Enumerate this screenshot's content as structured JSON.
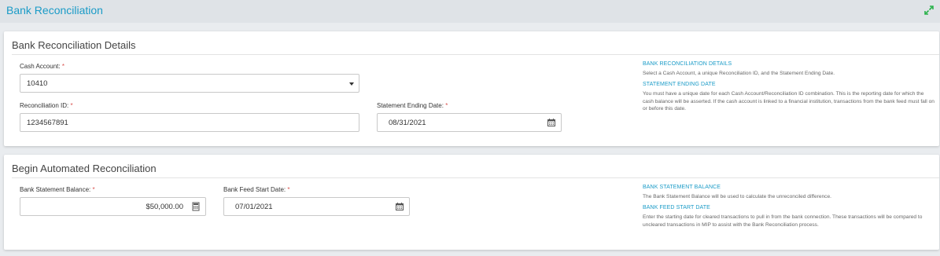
{
  "header": {
    "title": "Bank Reconciliation",
    "expand_icon": "expand-arrows-icon"
  },
  "details": {
    "title": "Bank Reconciliation Details",
    "cash_account": {
      "label": "Cash Account:",
      "required": "*",
      "value": "10410"
    },
    "reconciliation_id": {
      "label": "Reconciliation ID:",
      "required": "*",
      "value": "1234567891"
    },
    "statement_ending_date": {
      "label": "Statement Ending Date:",
      "required": "*",
      "value": "08/31/2021",
      "icon": "calendar-icon"
    },
    "help": [
      {
        "heading": "BANK RECONCILIATION DETAILS",
        "text": "Select a Cash Account, a unique Reconciliation ID, and the Statement Ending Date."
      },
      {
        "heading": "STATEMENT ENDING DATE",
        "text": "You must have a unique date for each Cash Account/Reconciliation ID combination. This is the reporting date for which the cash balance will be asserted. If the cash account is linked to a financial institution, transactions from the bank feed must fall on or before this date."
      }
    ]
  },
  "automated": {
    "title": "Begin Automated Reconciliation",
    "bank_statement_balance": {
      "label": "Bank Statement Balance:",
      "required": "*",
      "value": "$50,000.00",
      "icon": "calculator-icon"
    },
    "bank_feed_start_date": {
      "label": "Bank Feed Start Date:",
      "required": "*",
      "value": "07/01/2021",
      "icon": "calendar-icon"
    },
    "help": [
      {
        "heading": "BANK STATEMENT BALANCE",
        "text": "The Bank Statement Balance will be used to calculate the unreconciled difference."
      },
      {
        "heading": "BANK FEED START DATE",
        "text": "Enter the starting date for cleared transactions to pull in from the bank connection. These transactions will be compared to uncleared transactions in MIP to assist with the Bank Reconciliation process."
      }
    ]
  },
  "colors": {
    "accent": "#1a9bc7",
    "required": "#d9534f"
  }
}
